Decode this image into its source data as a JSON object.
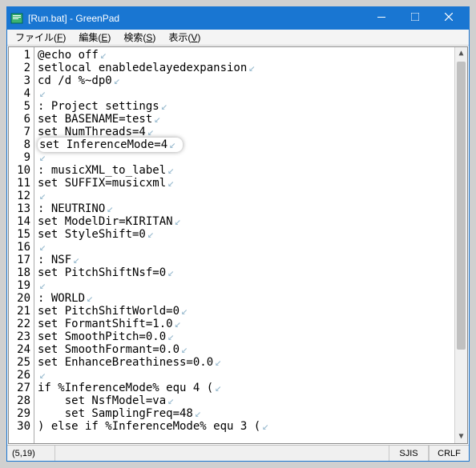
{
  "window": {
    "title": "[Run.bat] - GreenPad"
  },
  "menubar": [
    {
      "label": "ファイル",
      "mnemonic": "F"
    },
    {
      "label": "編集",
      "mnemonic": "E"
    },
    {
      "label": "検索",
      "mnemonic": "S"
    },
    {
      "label": "表示",
      "mnemonic": "V"
    }
  ],
  "editor": {
    "highlight_line": 8,
    "lines": [
      "@echo off",
      "setlocal enabledelayedexpansion",
      "cd /d %~dp0",
      "",
      ": Project settings",
      "set BASENAME=test",
      "set NumThreads=4",
      "set InferenceMode=4",
      "",
      ": musicXML_to_label",
      "set SUFFIX=musicxml",
      "",
      ": NEUTRINO",
      "set ModelDir=KIRITAN",
      "set StyleShift=0",
      "",
      ": NSF",
      "set PitchShiftNsf=0",
      "",
      ": WORLD",
      "set PitchShiftWorld=0",
      "set FormantShift=1.0",
      "set SmoothPitch=0.0",
      "set SmoothFormant=0.0",
      "set EnhanceBreathiness=0.0",
      "",
      "if %InferenceMode% equ 4 (",
      "    set NsfModel=va",
      "    set SamplingFreq=48",
      ") else if %InferenceMode% equ 3 ("
    ],
    "eol_glyph": "↙"
  },
  "statusbar": {
    "cursor": "(5,19)",
    "encoding": "SJIS",
    "lineending": "CRLF"
  }
}
